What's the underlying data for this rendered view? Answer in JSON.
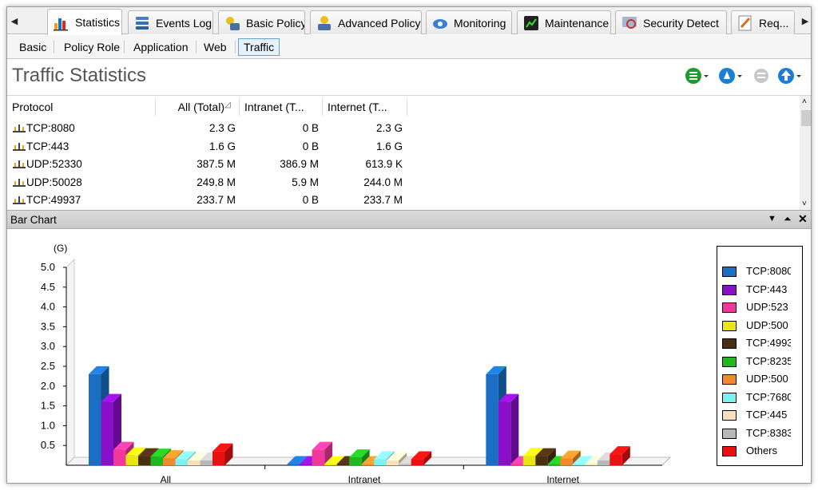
{
  "tabs": [
    {
      "label": "Statistics",
      "icon": "statistics-icon",
      "active": true
    },
    {
      "label": "Events Log",
      "icon": "events-log-icon"
    },
    {
      "label": "Basic Policy",
      "icon": "basic-policy-icon"
    },
    {
      "label": "Advanced Policy",
      "icon": "advanced-policy-icon"
    },
    {
      "label": "Monitoring",
      "icon": "monitoring-icon"
    },
    {
      "label": "Maintenance",
      "icon": "maintenance-icon"
    },
    {
      "label": "Security Detect",
      "icon": "security-detect-icon"
    },
    {
      "label": "Req...",
      "icon": "request-icon"
    }
  ],
  "subtabs": [
    "Basic",
    "Policy Role",
    "Application",
    "Web",
    "Traffic"
  ],
  "active_subtab": "Traffic",
  "page_title": "Traffic Statistics",
  "table": {
    "columns": [
      "Protocol",
      "All (Total)",
      "Intranet (T...",
      "Internet (T..."
    ],
    "rows": [
      {
        "protocol": "TCP:8080",
        "all": "2.3 G",
        "intranet": "0 B",
        "internet": "2.3 G"
      },
      {
        "protocol": "TCP:443",
        "all": "1.6 G",
        "intranet": "0 B",
        "internet": "1.6 G"
      },
      {
        "protocol": "UDP:52330",
        "all": "387.5 M",
        "intranet": "386.9 M",
        "internet": "613.9 K"
      },
      {
        "protocol": "UDP:50028",
        "all": "249.8 M",
        "intranet": "5.9 M",
        "internet": "244.0 M"
      },
      {
        "protocol": "TCP:49937",
        "all": "233.7 M",
        "intranet": "0 B",
        "internet": "233.7 M"
      }
    ]
  },
  "panel_title": "Bar Chart",
  "chart_data": {
    "type": "bar",
    "unit_label": "(G)",
    "categories": [
      "All",
      "Intranet",
      "Internet"
    ],
    "ylim": [
      0,
      5.0
    ],
    "yticks": [
      "5.0",
      "4.5",
      "4.0",
      "3.5",
      "3.0",
      "2.5",
      "2.0",
      "1.5",
      "1.0",
      "0.5"
    ],
    "series": [
      {
        "name": "TCP:8080",
        "color": "#1a6fc4",
        "values": [
          2.3,
          0.0,
          2.3
        ]
      },
      {
        "name": "TCP:443",
        "color": "#8a0fc9",
        "values": [
          1.6,
          0.0,
          1.6
        ]
      },
      {
        "name": "UDP:523",
        "color": "#f0389a",
        "values": [
          0.39,
          0.39,
          0.0
        ]
      },
      {
        "name": "UDP:500",
        "color": "#e8e810",
        "values": [
          0.25,
          0.01,
          0.24
        ]
      },
      {
        "name": "TCP:4993",
        "color": "#4a2e12",
        "values": [
          0.23,
          0.0,
          0.23
        ]
      },
      {
        "name": "TCP:8235",
        "color": "#1fb81f",
        "values": [
          0.22,
          0.2,
          0.02
        ]
      },
      {
        "name": "UDP:500",
        "color": "#f08a2a",
        "values": [
          0.18,
          0.01,
          0.17
        ]
      },
      {
        "name": "TCP:7680",
        "color": "#7ff0f0",
        "values": [
          0.15,
          0.15,
          0.0
        ]
      },
      {
        "name": "TCP:445",
        "color": "#fae0b8",
        "values": [
          0.12,
          0.12,
          0.0
        ]
      },
      {
        "name": "TCP:8383",
        "color": "#b8b8b8",
        "values": [
          0.12,
          0.0,
          0.12
        ]
      },
      {
        "name": "Others",
        "color": "#e81010",
        "values": [
          0.35,
          0.15,
          0.28
        ]
      }
    ]
  }
}
